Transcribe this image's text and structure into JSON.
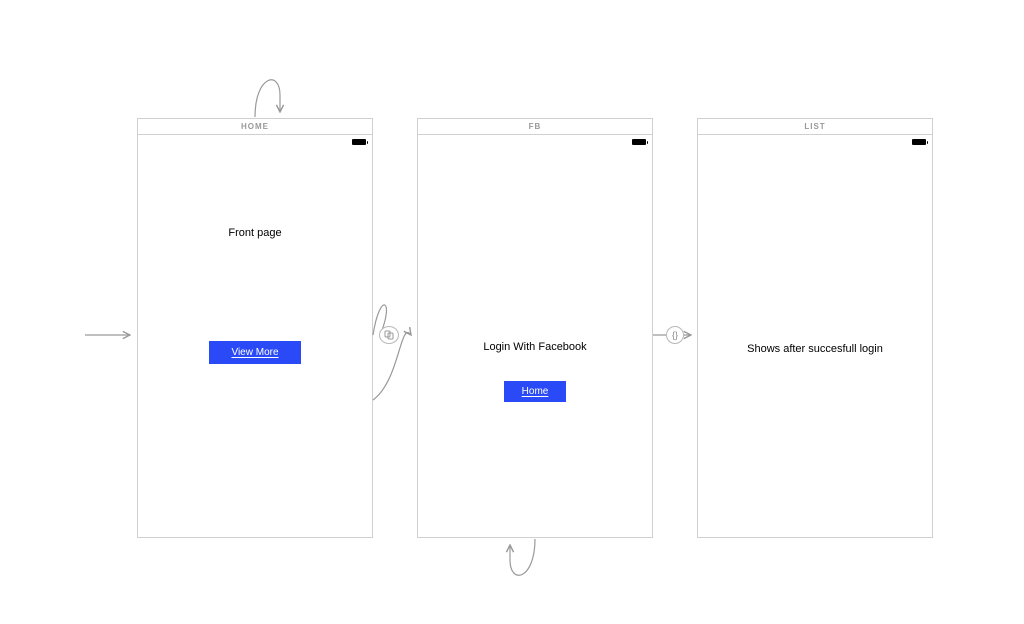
{
  "diagram": {
    "screens": [
      {
        "id": "home",
        "title": "HOME",
        "body_text": "Front page",
        "button_label": "View More"
      },
      {
        "id": "fb",
        "title": "FB",
        "body_text": "Login With Facebook",
        "button_label": "Home"
      },
      {
        "id": "list",
        "title": "LIST",
        "body_text": "Shows after succesfull login",
        "button_label": null
      }
    ],
    "connections": [
      {
        "from": "entry",
        "to": "home",
        "kind": "arrow"
      },
      {
        "from": "home",
        "to": "home",
        "kind": "self-loop-top"
      },
      {
        "from": "home",
        "to": "fb",
        "kind": "arrow",
        "badge": "link-copy"
      },
      {
        "from": "fb",
        "to": "list",
        "kind": "arrow",
        "badge": "braces"
      },
      {
        "from": "fb",
        "to": "fb",
        "kind": "self-loop-bottom"
      }
    ]
  }
}
